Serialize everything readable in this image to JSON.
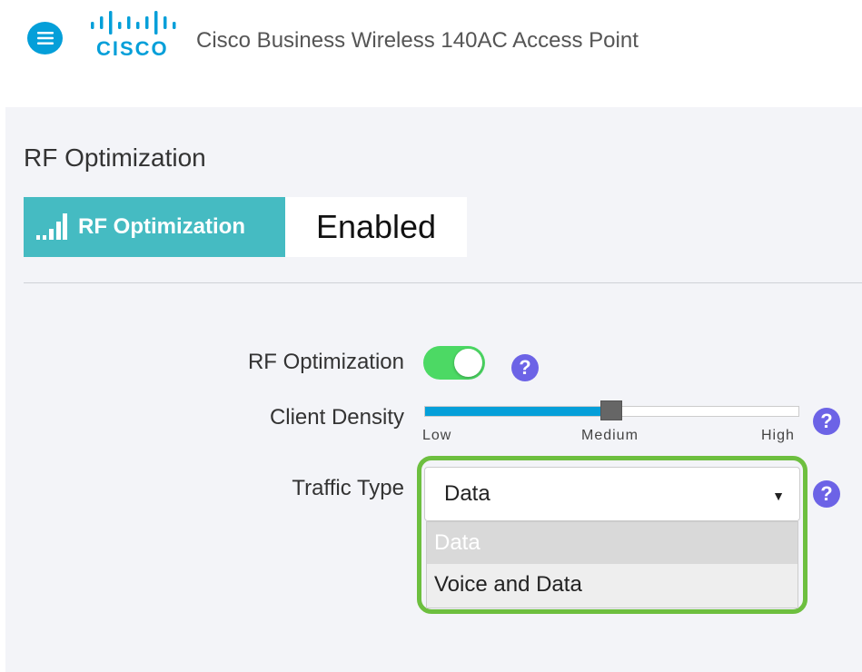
{
  "header": {
    "logo_text": "CISCO",
    "title": "Cisco Business Wireless 140AC Access Point",
    "menu_icon": "hamburger-menu-icon",
    "brand_color": "#049fd9"
  },
  "page": {
    "section_title": "RF Optimization",
    "tab": {
      "label": "RF Optimization",
      "icon": "signal-bars-icon",
      "color": "#45bbc2"
    },
    "status": "Enabled"
  },
  "form": {
    "rf_optimization": {
      "label": "RF Optimization",
      "enabled": true
    },
    "client_density": {
      "label": "Client Density",
      "ticks": {
        "low": "Low",
        "medium": "Medium",
        "high": "High"
      },
      "selected": "Medium",
      "level": 0.5
    },
    "traffic_type": {
      "label": "Traffic Type",
      "value": "Data",
      "options": [
        "Data",
        "Voice and Data"
      ],
      "highlight_color": "#6dbf3f"
    },
    "help_icon": "question-mark-icon",
    "help_symbol": "?"
  }
}
